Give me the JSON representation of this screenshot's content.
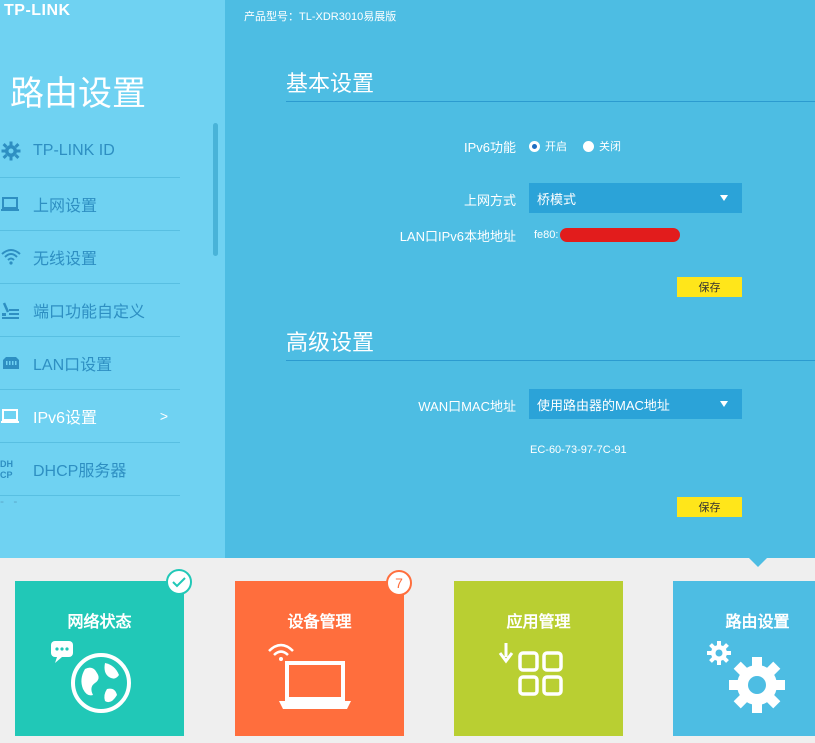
{
  "brand": {
    "logo": "TP-LINK"
  },
  "header": {
    "model": "产品型号：TL-XDR3010易展版"
  },
  "sidebar": {
    "title": "路由设置",
    "items": [
      {
        "label": "TP-LINK ID",
        "icon": "gear-icon"
      },
      {
        "label": "上网设置",
        "icon": "monitor-icon"
      },
      {
        "label": "无线设置",
        "icon": "wifi-icon"
      },
      {
        "label": "端口功能自定义",
        "icon": "port-config-icon"
      },
      {
        "label": "LAN口设置",
        "icon": "ethernet-icon"
      },
      {
        "label": "IPv6设置",
        "icon": "laptop-icon",
        "active": true,
        "chevron": ">"
      },
      {
        "label": "DHCP服务器",
        "icon": "dhcp-icon"
      }
    ],
    "more": "- -"
  },
  "basic": {
    "title": "基本设置",
    "ipv6_label": "IPv6功能",
    "radio_on": "开启",
    "radio_off": "关闭",
    "ipv6_enabled": true,
    "mode_label": "上网方式",
    "mode_value": "桥模式",
    "lan_label": "LAN口IPv6本地地址",
    "lan_value": "fe80:",
    "save": "保存"
  },
  "advanced": {
    "title": "高级设置",
    "mac_label": "WAN口MAC地址",
    "mac_value": "使用路由器的MAC地址",
    "mac_address": "EC-60-73-97-7C-91",
    "save": "保存"
  },
  "tiles": [
    {
      "label": "网络状态",
      "color": "#21c8b7",
      "icon": "globe-chat-icon",
      "badge": "check"
    },
    {
      "label": "设备管理",
      "color": "#ff6e3d",
      "icon": "laptop-wifi-icon",
      "badge": "7"
    },
    {
      "label": "应用管理",
      "color": "#b9cf32",
      "icon": "apps-grid-icon"
    },
    {
      "label": "路由设置",
      "color": "#4dbde3",
      "icon": "gears-icon",
      "active": true
    }
  ],
  "colors": {
    "panel": "#4dbde3",
    "sidebar": "#6fd2f2",
    "save_button": "#ffe61a",
    "select": "#2ba3d8"
  }
}
